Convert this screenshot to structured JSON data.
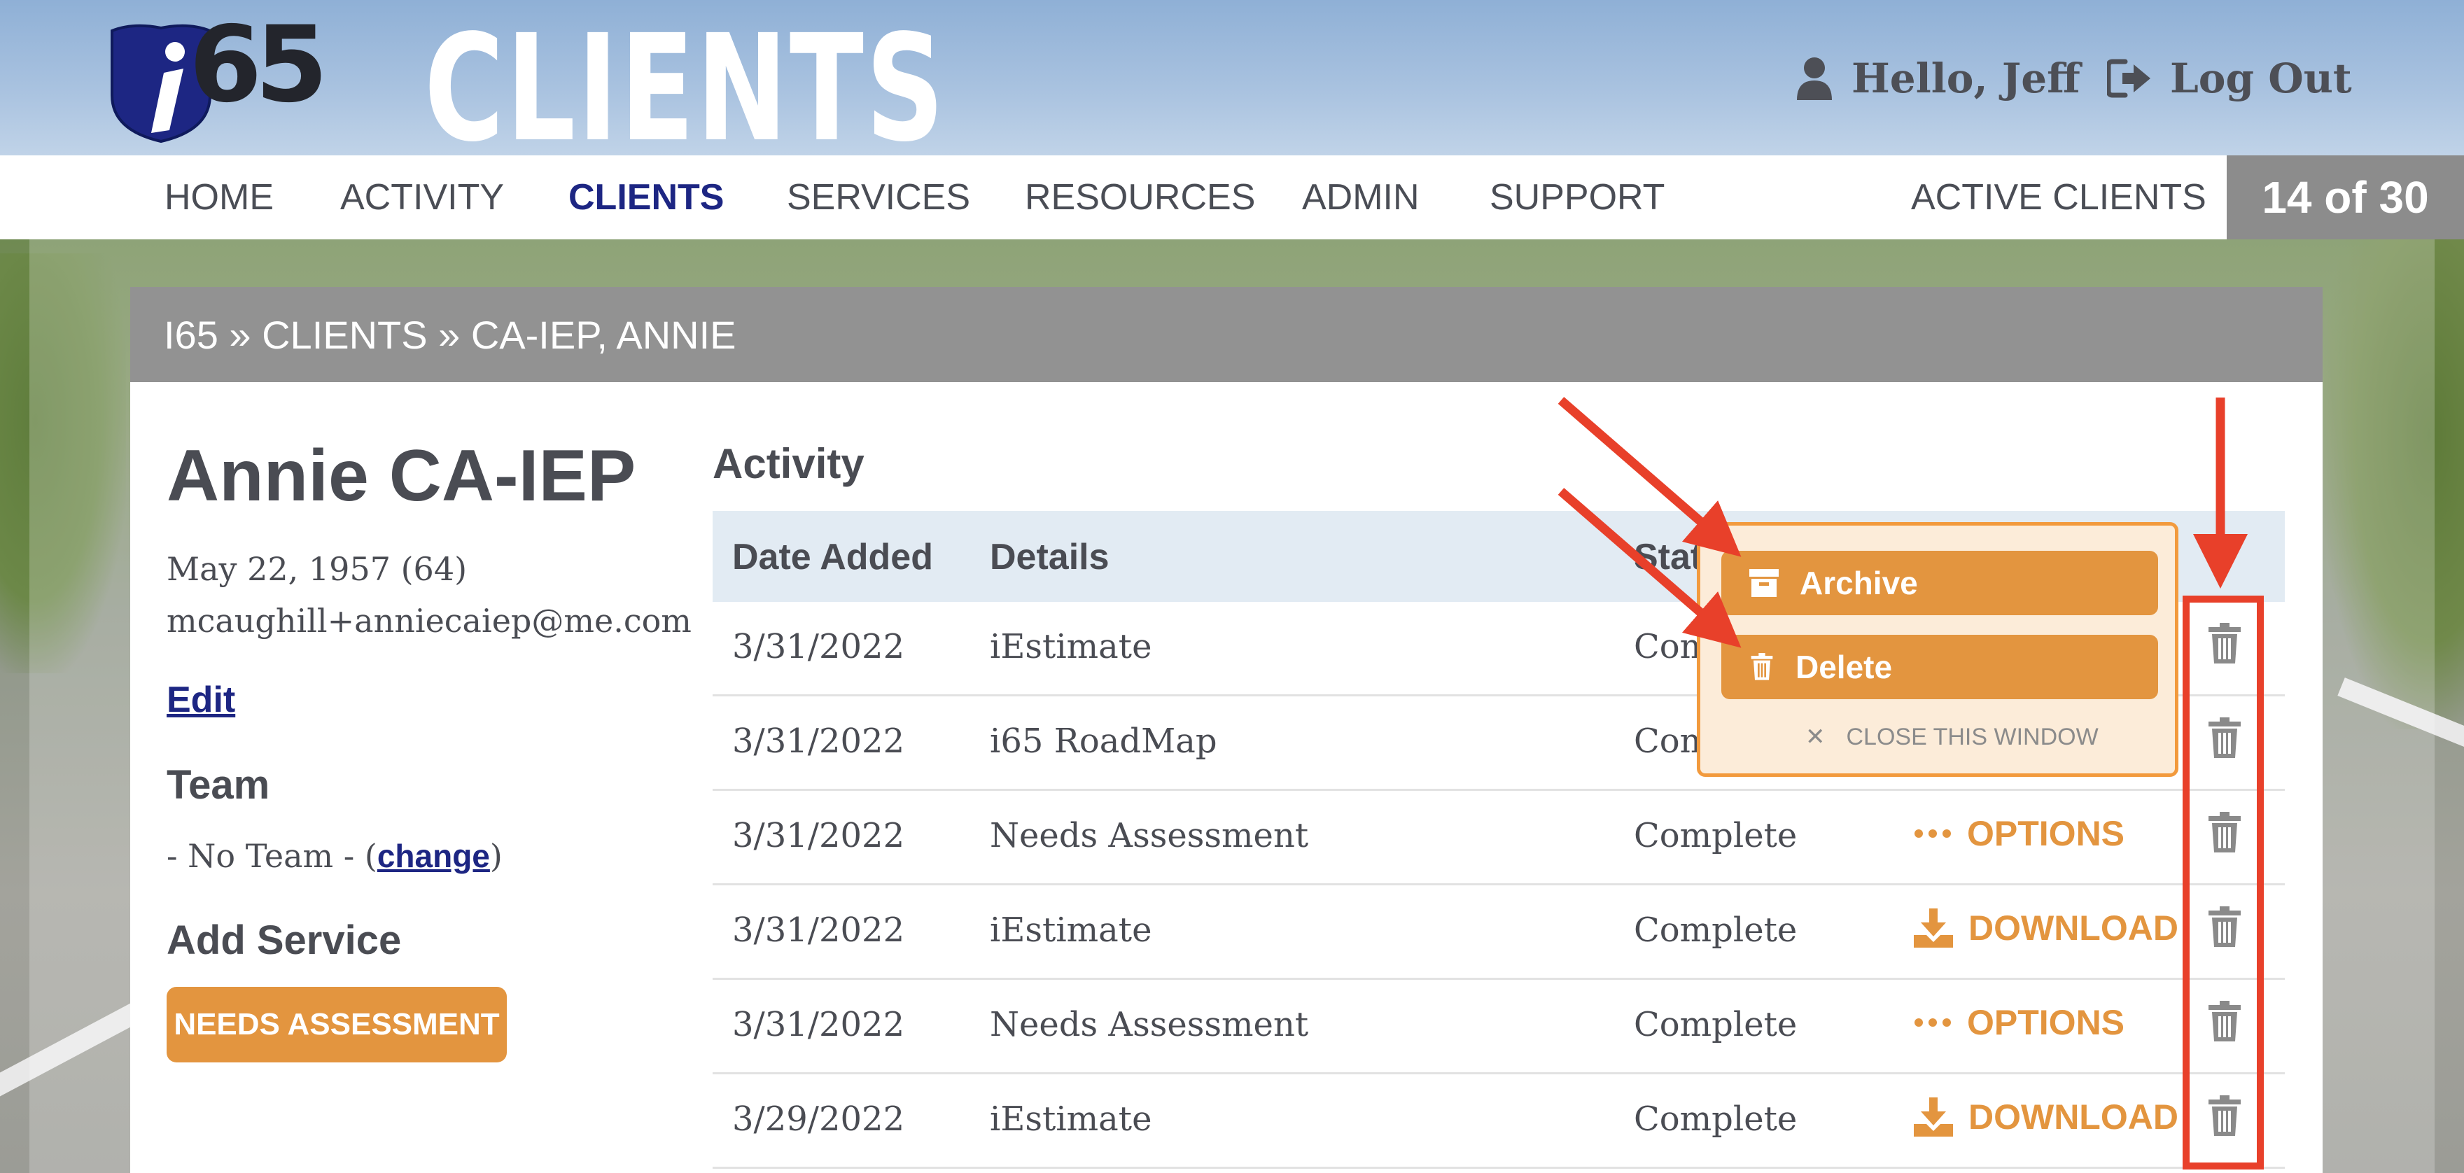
{
  "header": {
    "logo_text": "65",
    "app_title": "CLIENTS",
    "greeting": "Hello, Jeff",
    "logout_label": "Log Out"
  },
  "nav": {
    "items": [
      "HOME",
      "ACTIVITY",
      "CLIENTS",
      "SERVICES",
      "RESOURCES",
      "ADMIN",
      "SUPPORT"
    ],
    "active_item": "CLIENTS",
    "active_clients_label": "ACTIVE CLIENTS",
    "active_clients_count": "14 of 30"
  },
  "breadcrumb": "I65 » CLIENTS » CA-IEP, ANNIE",
  "client": {
    "name": "Annie CA-IEP",
    "dob": "May 22, 1957 (64)",
    "email": "mcaughill+anniecaiep@me.com",
    "edit_label": "Edit",
    "team_heading": "Team",
    "team_prefix": "- No Team - (",
    "team_change": "change",
    "team_suffix": ")",
    "add_service_heading": "Add Service",
    "service_button": "NEEDS ASSESSMENT"
  },
  "activity": {
    "title": "Activity",
    "columns": [
      "Date Added",
      "Details",
      "Status"
    ],
    "rows": [
      {
        "date": "3/31/2022",
        "details": "iEstimate",
        "status": "Complete",
        "action": ""
      },
      {
        "date": "3/31/2022",
        "details": "i65 RoadMap",
        "status": "Complete",
        "action": ""
      },
      {
        "date": "3/31/2022",
        "details": "Needs Assessment",
        "status": "Complete",
        "action": "OPTIONS"
      },
      {
        "date": "3/31/2022",
        "details": "iEstimate",
        "status": "Complete",
        "action": "DOWNLOAD"
      },
      {
        "date": "3/31/2022",
        "details": "Needs Assessment",
        "status": "Complete",
        "action": "OPTIONS"
      },
      {
        "date": "3/29/2022",
        "details": "iEstimate",
        "status": "Complete",
        "action": "DOWNLOAD"
      }
    ]
  },
  "popup": {
    "archive_label": "Archive",
    "delete_label": "Delete",
    "close_label": "CLOSE THIS WINDOW"
  },
  "colors": {
    "accent_orange": "#e3953f",
    "nav_active": "#1d2683",
    "annotation_red": "#e8402a"
  }
}
